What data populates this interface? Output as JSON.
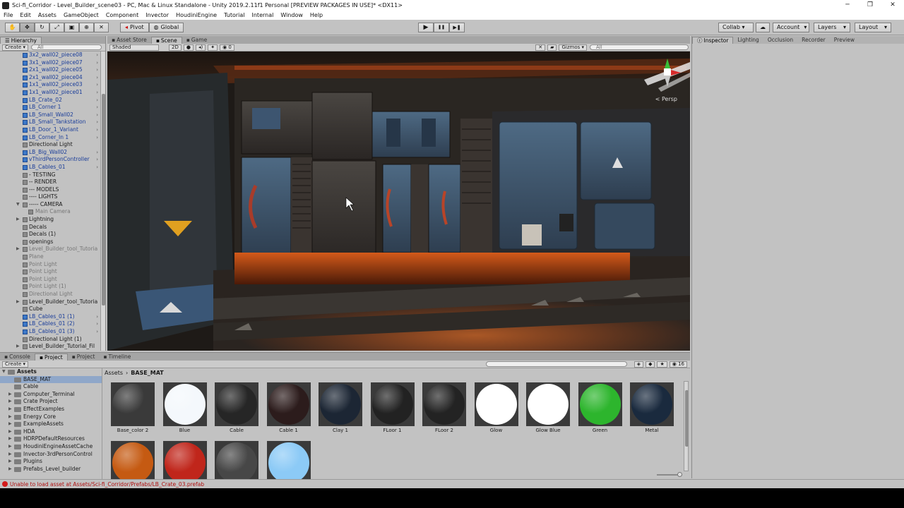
{
  "window": {
    "title": "Sci-fi_Corridor - Level_Builder_scene03 - PC, Mac & Linux Standalone - Unity 2019.2.11f1 Personal [PREVIEW PACKAGES IN USE]* <DX11>",
    "minimize": "─",
    "maximize": "❐",
    "close": "✕"
  },
  "menu": [
    "File",
    "Edit",
    "Assets",
    "GameObject",
    "Component",
    "Invector",
    "HoudiniEngine",
    "Tutorial",
    "Internal",
    "Window",
    "Help"
  ],
  "toolbar": {
    "tools": [
      "hand-tool",
      "move-tool",
      "rotate-tool",
      "scale-tool",
      "rect-tool",
      "transform-tool",
      "custom-tool"
    ],
    "pivot_label": "Pivot",
    "global_label": "Global",
    "play": "▶",
    "pause": "❚❚",
    "step": "▶❚",
    "collab_label": "Collab ▾",
    "account_label": "Account",
    "layers_label": "Layers",
    "layout_label": "Layout"
  },
  "hierarchy": {
    "tab": "Hierarchy",
    "create_label": "Create ▾",
    "search_placeholder": "All",
    "items": [
      {
        "label": "3x2_wall02_piece08",
        "type": "prefab",
        "chev": true
      },
      {
        "label": "3x1_wall02_piece07",
        "type": "prefab",
        "chev": true
      },
      {
        "label": "2x1_wall02_piece05",
        "type": "prefab",
        "chev": true
      },
      {
        "label": "2x1_wall02_piece04",
        "type": "prefab",
        "chev": true
      },
      {
        "label": "1x1_wall02_piece03",
        "type": "prefab",
        "chev": true
      },
      {
        "label": "1x1_wall02_piece01",
        "type": "prefab",
        "chev": true
      },
      {
        "label": "LB_Crate_02",
        "type": "prefab",
        "chev": true
      },
      {
        "label": "LB_Corner 1",
        "type": "prefab",
        "chev": true
      },
      {
        "label": "LB_Small_Wall02",
        "type": "prefab",
        "chev": true
      },
      {
        "label": "LB_Small_Tankstation",
        "type": "prefab",
        "chev": true
      },
      {
        "label": "LB_Door_1_Variant",
        "type": "prefab",
        "chev": true
      },
      {
        "label": "LB_Corner_In 1",
        "type": "prefab",
        "chev": true
      },
      {
        "label": "Directional Light",
        "type": "normal"
      },
      {
        "label": "LB_Big_Wall02",
        "type": "prefab",
        "chev": true
      },
      {
        "label": "vThirdPersonController",
        "type": "prefab",
        "chev": true
      },
      {
        "label": "LB_Cables_01",
        "type": "prefab",
        "chev": true
      },
      {
        "label": "- TESTING",
        "type": "normal"
      },
      {
        "label": "-- RENDER",
        "type": "normal"
      },
      {
        "label": "--- MODELS",
        "type": "normal"
      },
      {
        "label": "---- LIGHTS",
        "type": "normal"
      },
      {
        "label": "----- CAMERA",
        "type": "normal",
        "expanded": true
      },
      {
        "label": "Main Camera",
        "type": "disabled",
        "indent": true
      },
      {
        "label": "Lightning",
        "type": "normal",
        "arrow": true
      },
      {
        "label": "Decals",
        "type": "normal"
      },
      {
        "label": "Decals (1)",
        "type": "normal"
      },
      {
        "label": "openings",
        "type": "normal"
      },
      {
        "label": "Level_Builder_tool_Tutoria",
        "type": "disabled",
        "arrow": true
      },
      {
        "label": "Plane",
        "type": "disabled"
      },
      {
        "label": "Point Light",
        "type": "disabled"
      },
      {
        "label": "Point Light",
        "type": "disabled"
      },
      {
        "label": "Point Light",
        "type": "disabled"
      },
      {
        "label": "Point Light (1)",
        "type": "disabled"
      },
      {
        "label": "Directional Light",
        "type": "disabled"
      },
      {
        "label": "Level_Builder_tool_Tutoria",
        "type": "normal",
        "arrow": true
      },
      {
        "label": "Cube",
        "type": "normal"
      },
      {
        "label": "LB_Cables_01 (1)",
        "type": "prefab",
        "chev": true
      },
      {
        "label": "LB_Cables_01 (2)",
        "type": "prefab",
        "chev": true
      },
      {
        "label": "LB_Cables_01 (3)",
        "type": "prefab",
        "chev": true
      },
      {
        "label": "Directional Light (1)",
        "type": "normal"
      },
      {
        "label": "Level_Builder_Tutorial_Fil",
        "type": "normal",
        "arrow": true
      }
    ]
  },
  "scene": {
    "tabs": [
      "Asset Store",
      "Scene",
      "Game"
    ],
    "shading_label": "Shaded",
    "mode_2d": "2D",
    "fx_count": "0",
    "gizmos_label": "Gizmos ▾",
    "search_placeholder": "All",
    "persp_label": "< Persp"
  },
  "inspector": {
    "tabs": [
      "Inspector",
      "Lighting",
      "Occlusion",
      "Recorder",
      "Preview"
    ]
  },
  "project": {
    "tabs": [
      "Console",
      "Project",
      "Project",
      "Timeline"
    ],
    "create_label": "Create ▾",
    "hidden_count": "16",
    "breadcrumb": [
      "Assets",
      "BASE_MAT"
    ],
    "tree": [
      {
        "label": "Assets",
        "level": 0,
        "bold": true,
        "expanded": true
      },
      {
        "label": "BASE_MAT",
        "level": 1,
        "selected": true
      },
      {
        "label": "Cable",
        "level": 1
      },
      {
        "label": "Computer_Terminal",
        "level": 1,
        "arrow": true
      },
      {
        "label": "Crate Project",
        "level": 1,
        "arrow": true
      },
      {
        "label": "EffectExamples",
        "level": 1,
        "arrow": true
      },
      {
        "label": "Energy Core",
        "level": 1,
        "arrow": true
      },
      {
        "label": "ExampleAssets",
        "level": 1,
        "arrow": true
      },
      {
        "label": "HDA",
        "level": 1,
        "arrow": true
      },
      {
        "label": "HDRPDefaultResources",
        "level": 1,
        "arrow": true
      },
      {
        "label": "HoudiniEngineAssetCache",
        "level": 1,
        "arrow": true
      },
      {
        "label": "Invector-3rdPersonControl",
        "level": 1,
        "arrow": true
      },
      {
        "label": "Plugins",
        "level": 1,
        "arrow": true
      },
      {
        "label": "Prefabs_Level_builder",
        "level": 1,
        "arrow": true
      }
    ],
    "assets": [
      {
        "name": "Base_color 2",
        "color": "#3a3a3a"
      },
      {
        "name": "Blue",
        "color": "#f4f8fc"
      },
      {
        "name": "Cable",
        "color": "#262626"
      },
      {
        "name": "Cable 1",
        "color": "#2c1c1c"
      },
      {
        "name": "Clay 1",
        "color": "#1c2634"
      },
      {
        "name": "FLoor 1",
        "color": "#222222"
      },
      {
        "name": "FLoor 2",
        "color": "#232323"
      },
      {
        "name": "Glow",
        "color": "#ffffff"
      },
      {
        "name": "Glow Blue",
        "color": "#ffffff"
      },
      {
        "name": "Green",
        "color": "#2db52d"
      },
      {
        "name": "Metal",
        "color": "#1a2a3e"
      },
      {
        "name": "",
        "color": "#c55a12"
      },
      {
        "name": "",
        "color": "#c0261b"
      },
      {
        "name": "",
        "color": "#474747"
      },
      {
        "name": "",
        "color": "#8ccaf6"
      }
    ]
  },
  "status": {
    "message": "Unable to load asset at Assets/Sci-fi_Corridor/Prefabs/LB_Crate_03.prefab"
  }
}
